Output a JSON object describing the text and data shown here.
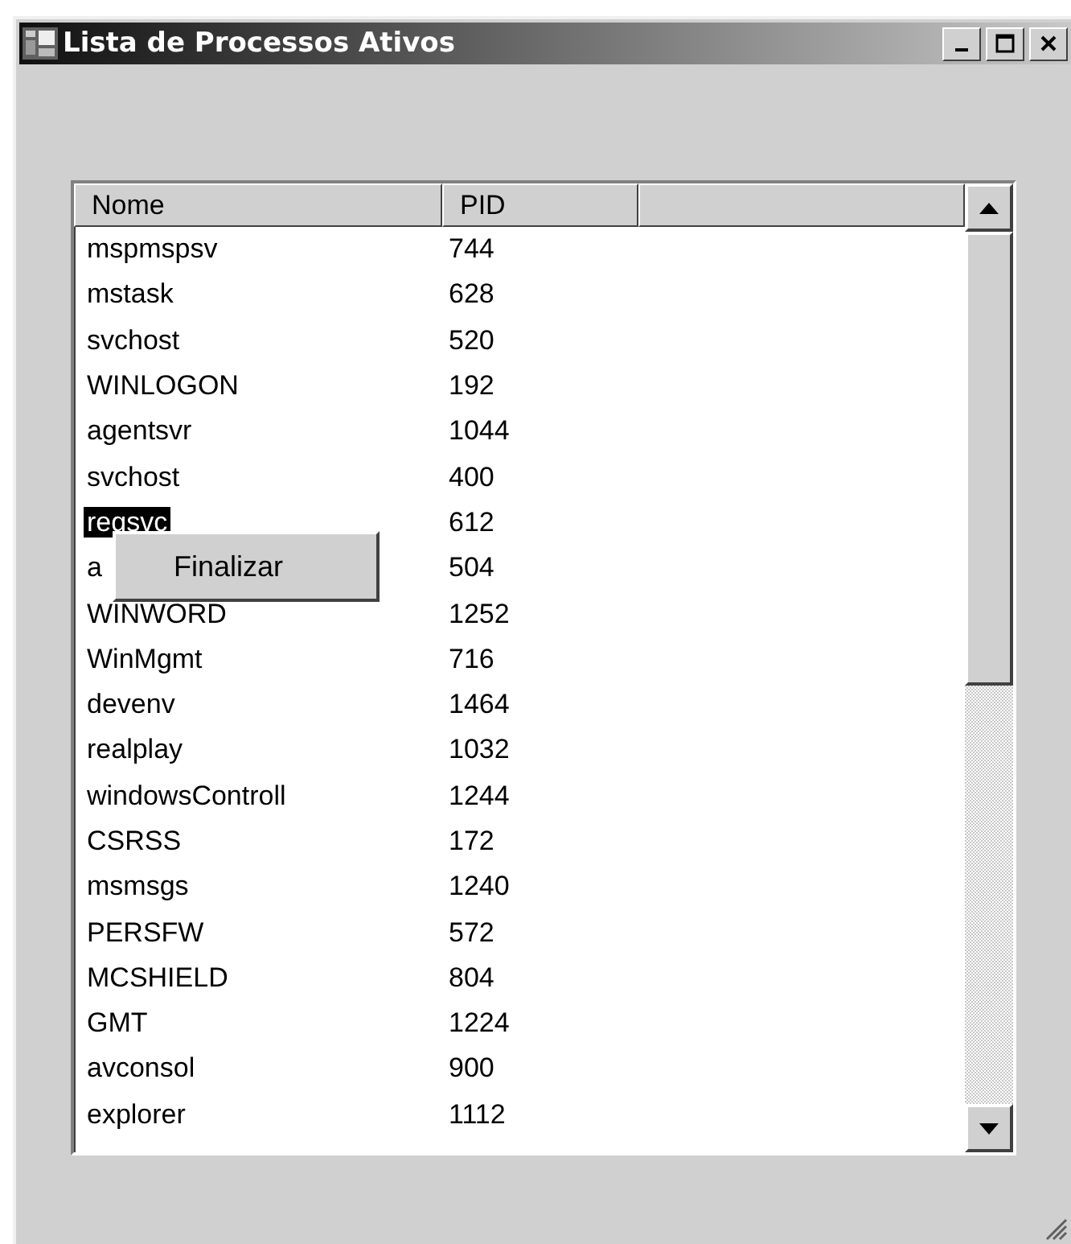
{
  "window": {
    "title": "Lista de Processos Ativos"
  },
  "table": {
    "columns": [
      "Nome",
      "PID"
    ],
    "rows": [
      {
        "name": "mspmspsv",
        "pid": "744",
        "selected": false
      },
      {
        "name": "mstask",
        "pid": "628",
        "selected": false
      },
      {
        "name": "svchost",
        "pid": "520",
        "selected": false
      },
      {
        "name": "WINLOGON",
        "pid": "192",
        "selected": false
      },
      {
        "name": "agentsvr",
        "pid": "1044",
        "selected": false
      },
      {
        "name": "svchost",
        "pid": "400",
        "selected": false
      },
      {
        "name": "regsvc",
        "pid": "612",
        "selected": true
      },
      {
        "name": "a",
        "pid": "504",
        "selected": false
      },
      {
        "name": "WINWORD",
        "pid": "1252",
        "selected": false
      },
      {
        "name": "WinMgmt",
        "pid": "716",
        "selected": false
      },
      {
        "name": "devenv",
        "pid": "1464",
        "selected": false
      },
      {
        "name": "realplay",
        "pid": "1032",
        "selected": false
      },
      {
        "name": "windowsControll",
        "pid": "1244",
        "selected": false
      },
      {
        "name": "CSRSS",
        "pid": "172",
        "selected": false
      },
      {
        "name": "msmsgs",
        "pid": "1240",
        "selected": false
      },
      {
        "name": "PERSFW",
        "pid": "572",
        "selected": false
      },
      {
        "name": "MCSHIELD",
        "pid": "804",
        "selected": false
      },
      {
        "name": "GMT",
        "pid": "1224",
        "selected": false
      },
      {
        "name": "avconsol",
        "pid": "900",
        "selected": false
      },
      {
        "name": "explorer",
        "pid": "1112",
        "selected": false
      }
    ]
  },
  "context_menu": {
    "items": [
      "Finalizar"
    ]
  }
}
